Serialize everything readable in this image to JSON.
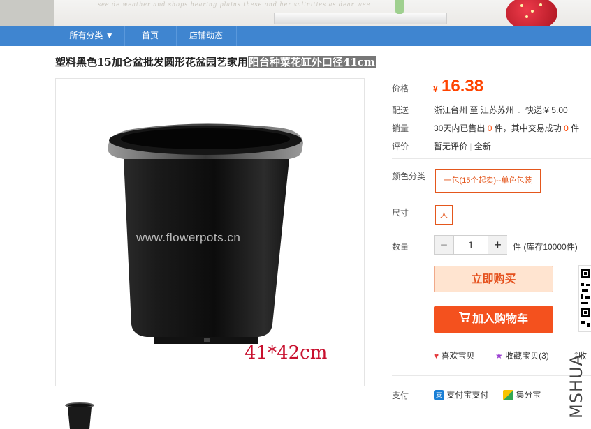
{
  "nav": {
    "all_categories": "所有分类 ▼",
    "home": "首页",
    "shop_news": "店铺动态"
  },
  "banner": {
    "script_text": "see de weather and shops hearing plains these and her salinities as dear wee"
  },
  "product": {
    "title_plain": "塑料黑色15加仑盆批发圆形花盆园艺家用",
    "title_selected": "阳台种菜花缸外口径41cm",
    "image_watermark": "www.flowerpots.cn",
    "image_dimensions": "41*42cm"
  },
  "details": {
    "price_label": "价格",
    "currency": "¥",
    "price": "16.38",
    "shipping_label": "配送",
    "shipping_from": "浙江台州",
    "shipping_to_word": "至",
    "shipping_to": "江苏苏州",
    "shipping_express": "快递:¥ 5.00",
    "sales_label": "销量",
    "sales_prefix": "30天内已售出",
    "sales_count": "0",
    "sales_mid": "件，其中交易成功",
    "sales_success": "0",
    "sales_suffix": "件",
    "rating_label": "评价",
    "rating_none": "暂无评价",
    "rating_sep": "|",
    "rating_new": "全新",
    "color_label": "颜色分类",
    "color_option": "一包(15个起卖)--单色包装",
    "size_label": "尺寸",
    "size_option": "大",
    "quantity_label": "数量",
    "quantity_minus": "−",
    "quantity_value": "1",
    "quantity_plus": "+",
    "stock_text": "件 (库存10000件)",
    "buy_now": "立即购买",
    "add_to_cart": "加入购物车",
    "like": "喜欢宝贝",
    "favorite": "收藏宝贝(3)",
    "truncated_link": "收",
    "payment_label": "支付",
    "alipay": "支付宝支付",
    "jifenbao": "集分宝"
  },
  "side": {
    "brand_vertical": "MSHUA"
  },
  "colors": {
    "nav_bg": "#3f85d0",
    "accent_orange": "#ff4400",
    "sku_border": "#e4571d",
    "buy_bg": "#ffe4d0",
    "cart_bg": "#f4511e"
  }
}
